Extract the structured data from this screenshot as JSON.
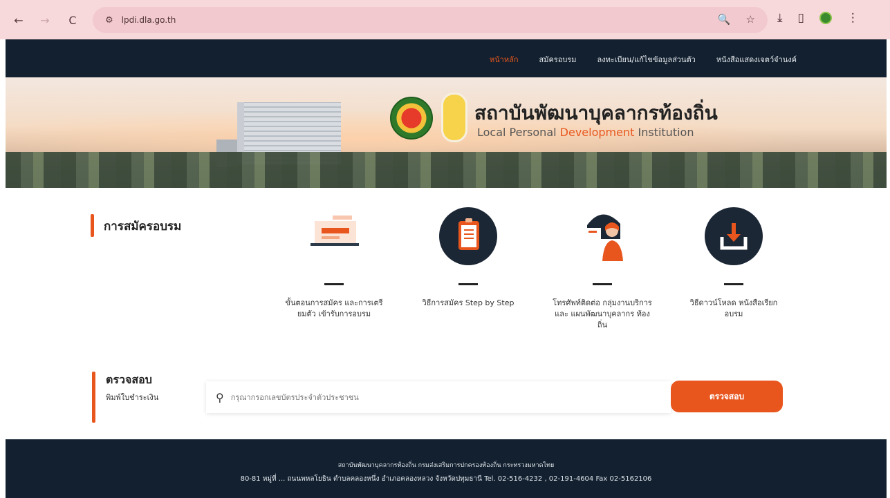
{
  "browser": {
    "url": "lpdi.dla.go.th",
    "back_icon": "←",
    "forward_icon": "→",
    "reload_icon": "C",
    "tune_icon": "⚙",
    "zoom_icon": "🔍",
    "star_icon": "☆",
    "download_icon": "⤓",
    "sidepanel_icon": "▯",
    "menu_icon": "⋮"
  },
  "nav": {
    "items": [
      {
        "label": "หน้าหลัก",
        "active": true
      },
      {
        "label": "สมัครอบรม"
      },
      {
        "label": "ลงทะเบียน/แก้ไขข้อมูลส่วนตัว"
      },
      {
        "label": "หนังสือแสดงเจตว์จำนงค์"
      }
    ]
  },
  "hero": {
    "title_th": "สถาบันพัฒนาบุคลากรท้องถิ่น",
    "title_en_a": "Local Personal",
    "title_en_b": "Development",
    "title_en_c": "Institution"
  },
  "registration": {
    "title": "การสมัครอบรม",
    "features": [
      {
        "icon": "laptop-form-icon",
        "label": "ขั้นตอนการสมัคร และการเตรียมตัว เข้ารับการอบรม"
      },
      {
        "icon": "clipboard-icon",
        "label": "วิธีการสมัคร Step by Step"
      },
      {
        "icon": "support-person-icon",
        "label": "โทรศัพท์ติดต่อ กลุ่มงานบริการและ แผนพัฒนาบุคลากร ท้องถิ่น"
      },
      {
        "icon": "download-icon",
        "label": "วิธีดาวน์โหลด หนังสือเรียกอบรม"
      }
    ]
  },
  "check": {
    "title": "ตรวจสอบ",
    "subtitle": "พิมพ์ใบชำระเงิน",
    "placeholder": "กรุณากรอกเลขบัตรประจำตัวประชาชน",
    "button": "ตรวจสอบ"
  },
  "footer": {
    "line1": "สถาบันพัฒนาบุคลากรท้องถิ่น กรมส่งเสริมการปกครองท้องถิ่น กระทรวงมหาดไทย",
    "line2": "80-81 หมู่ที่ ... ถนนพหลโยธิน ตำบลคลองหนึ่ง อำเภอคลองหลวง จังหวัดปทุมธานี Tel. 02-516-4232 , 02-191-4604 Fax 02-5162106"
  },
  "colors": {
    "accent": "#e8561e",
    "nav_bg": "#12202f",
    "chrome_bg": "#f7d9dc"
  }
}
